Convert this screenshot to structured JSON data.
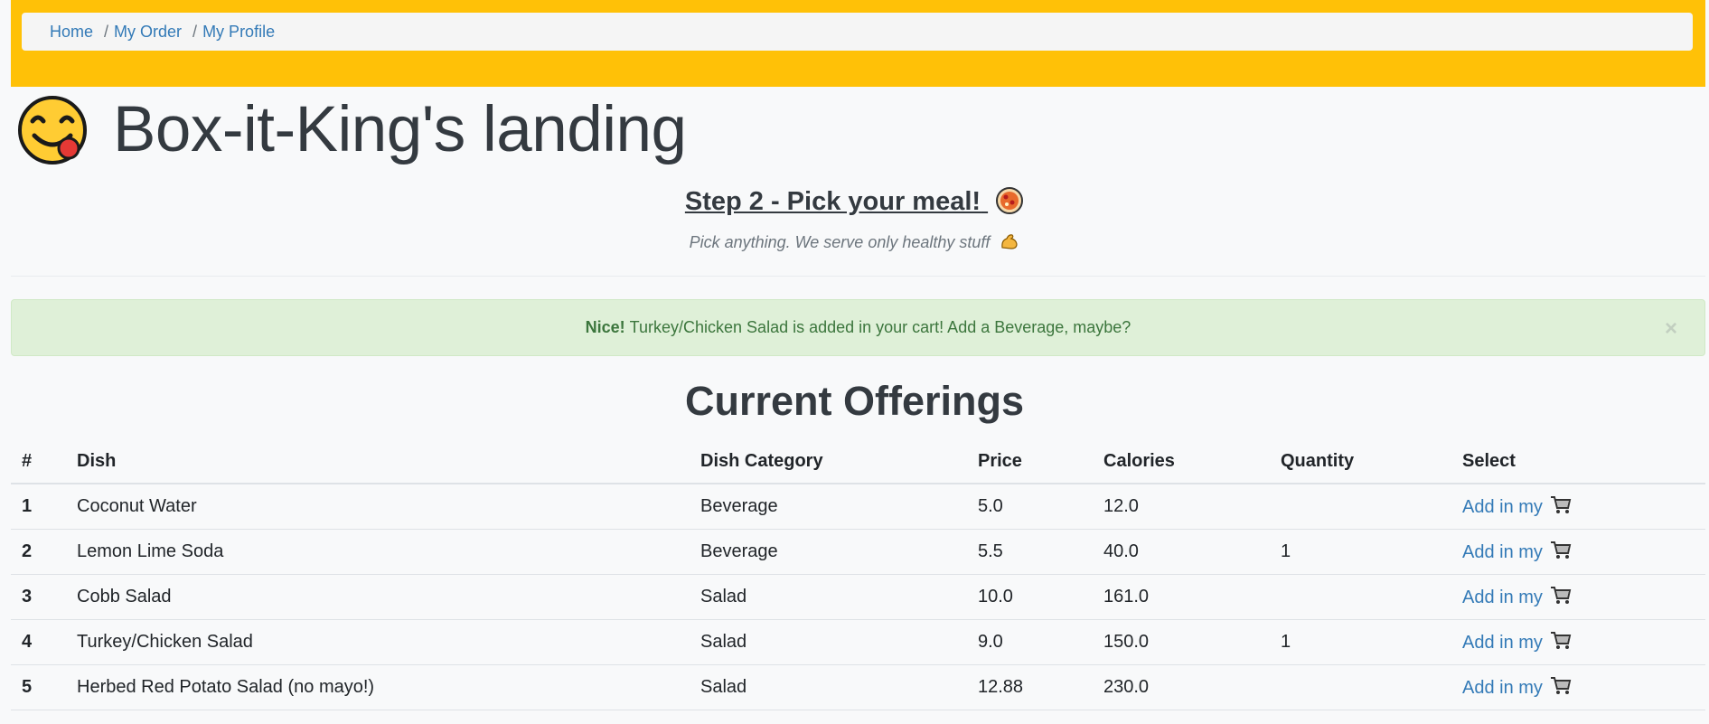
{
  "breadcrumb": {
    "items": [
      "Home",
      "My Order",
      "My Profile"
    ],
    "separator": "/"
  },
  "hero": {
    "title": "Box-it-King's landing",
    "icon": "face-savoring-food-icon"
  },
  "step": {
    "title": "Step 2 - Pick your meal!",
    "icon": "pizza-icon",
    "tagline": "Pick anything. We serve only healthy stuff",
    "tagline_icon": "flexed-biceps-icon"
  },
  "alert": {
    "strong": "Nice!",
    "message": "Turkey/Chicken Salad is added in your cart! Add a Beverage, maybe?",
    "close": "×"
  },
  "offerings": {
    "title": "Current Offerings",
    "columns": [
      "#",
      "Dish",
      "Dish Category",
      "Price",
      "Calories",
      "Quantity",
      "Select"
    ],
    "rows": [
      {
        "num": "1",
        "dish": "Coconut Water",
        "category": "Beverage",
        "price": "5.0",
        "calories": "12.0",
        "quantity": "",
        "select": "Add in my"
      },
      {
        "num": "2",
        "dish": "Lemon Lime Soda",
        "category": "Beverage",
        "price": "5.5",
        "calories": "40.0",
        "quantity": "1",
        "select": "Add in my"
      },
      {
        "num": "3",
        "dish": "Cobb Salad",
        "category": "Salad",
        "price": "10.0",
        "calories": "161.0",
        "quantity": "",
        "select": "Add in my"
      },
      {
        "num": "4",
        "dish": "Turkey/Chicken Salad",
        "category": "Salad",
        "price": "9.0",
        "calories": "150.0",
        "quantity": "1",
        "select": "Add in my"
      },
      {
        "num": "5",
        "dish": "Herbed Red Potato Salad (no mayo!)",
        "category": "Salad",
        "price": "12.88",
        "calories": "230.0",
        "quantity": "",
        "select": "Add in my"
      }
    ]
  },
  "colors": {
    "header": "#ffc107",
    "link": "#337ab7",
    "alert_bg": "#dff0d8",
    "alert_text": "#3c763d"
  }
}
